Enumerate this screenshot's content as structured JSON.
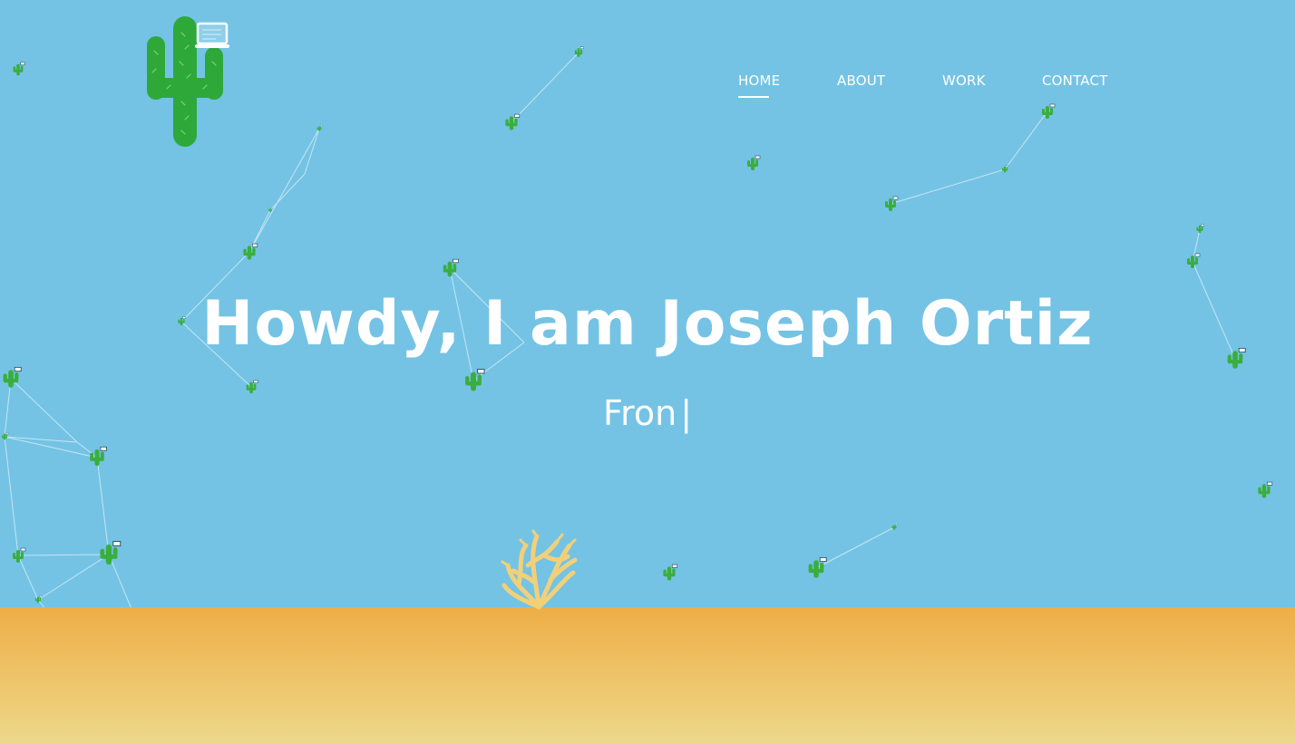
{
  "header": {
    "logo": {
      "icon": "cactus-laptop-icon",
      "cactus_color": "#2fa83a",
      "laptop_color": "#ffffff"
    }
  },
  "nav": {
    "items": [
      {
        "label": "HOME",
        "active": true
      },
      {
        "label": "ABOUT",
        "active": false
      },
      {
        "label": "WORK",
        "active": false
      },
      {
        "label": "CONTACT",
        "active": false
      }
    ]
  },
  "hero": {
    "title": "Howdy, I am Joseph Ortiz",
    "subtitle_typed": "Fron",
    "cursor": "|"
  },
  "background": {
    "sky_color": "#74c3e4",
    "ground_top_color": "#eeae46",
    "ground_bottom_color": "#edd88a",
    "particle_icon": "cactus-icon",
    "decoration_icon": "tumbleweed-icon",
    "tumbleweed_color": "#f1d07a"
  }
}
